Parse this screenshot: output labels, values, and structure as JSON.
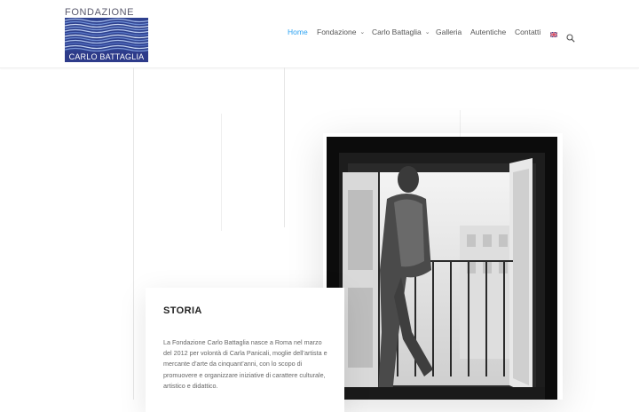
{
  "logo": {
    "top_text": "FONDAZIONE",
    "bottom_text": "CARLO BATTAGLIA"
  },
  "nav": {
    "items": [
      {
        "label": "Home",
        "active": true,
        "dropdown": false
      },
      {
        "label": "Fondazione",
        "active": false,
        "dropdown": true
      },
      {
        "label": "Carlo Battaglia",
        "active": false,
        "dropdown": true
      },
      {
        "label": "Galleria",
        "active": false,
        "dropdown": false
      },
      {
        "label": "Autentiche",
        "active": false,
        "dropdown": false
      },
      {
        "label": "Contatti",
        "active": false,
        "dropdown": false
      }
    ],
    "language_icon": "uk-flag-icon",
    "search_icon": "search-icon"
  },
  "story": {
    "title": "STORIA",
    "text": "La Fondazione Carlo Battaglia nasce a Roma nel marzo del 2012 per volontà di Carla Panicali, moglie dell’artista e mercante d’arte da cinquant’anni, con lo scopo di promuovere e organizzare iniziative di carattere culturale, artistico e didattico."
  },
  "colors": {
    "accent": "#2ea3f2",
    "logo_blue": "#2d3b8a"
  }
}
